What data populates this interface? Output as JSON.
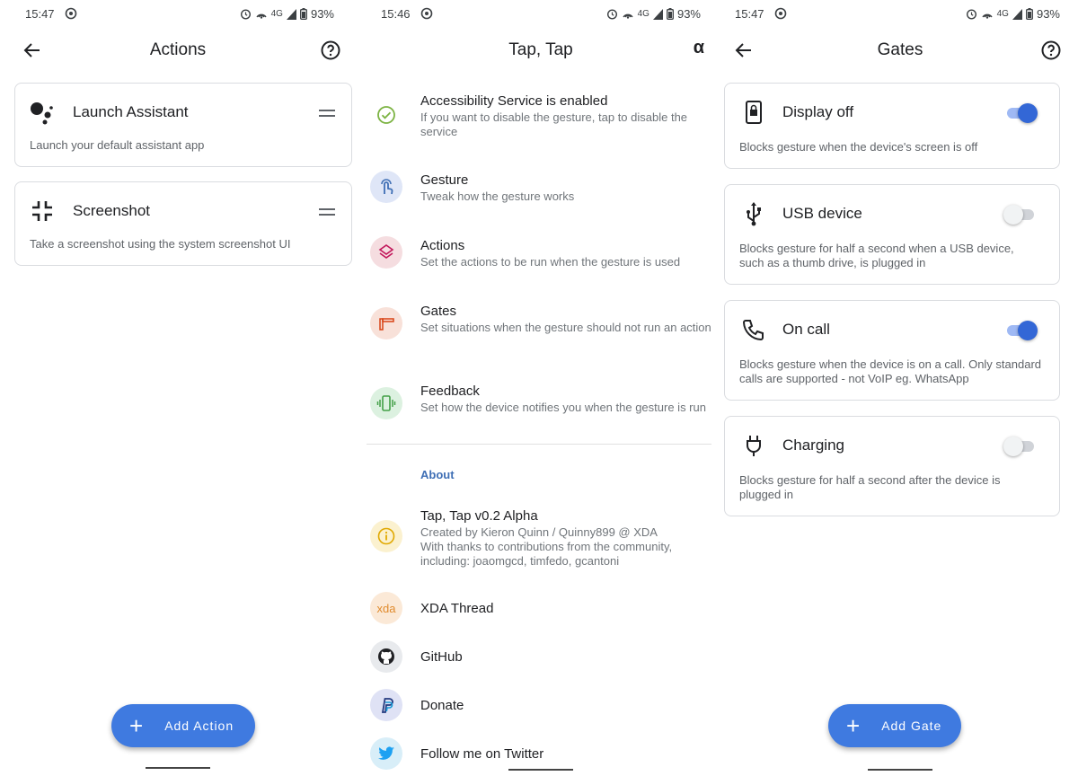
{
  "status": {
    "screen1": {
      "time": "15:47",
      "battery": "93%",
      "network": "4G"
    },
    "screen2": {
      "time": "15:46",
      "battery": "93%",
      "network": "4G"
    },
    "screen3": {
      "time": "15:47",
      "battery": "93%",
      "network": "4G"
    }
  },
  "actions_screen": {
    "title": "Actions",
    "cards": [
      {
        "title": "Launch Assistant",
        "description": "Launch your default assistant app"
      },
      {
        "title": "Screenshot",
        "description": "Take a screenshot using the system screenshot UI"
      }
    ],
    "fab_label": "Add Action"
  },
  "main_screen": {
    "title": "Tap, Tap",
    "alpha_symbol": "α",
    "items": [
      {
        "title": "Accessibility Service is enabled",
        "subtitle": "If you want to disable the gesture, tap to disable the service",
        "icon": "check-circle-icon"
      },
      {
        "title": "Gesture",
        "subtitle": "Tweak how the gesture works",
        "icon": "touch-icon"
      },
      {
        "title": "Actions",
        "subtitle": "Set the actions to be run when the gesture is used",
        "icon": "layers-icon"
      },
      {
        "title": "Gates",
        "subtitle": "Set situations when the gesture should not run an action",
        "icon": "gate-icon"
      },
      {
        "title": "Feedback",
        "subtitle": "Set how the device notifies you when the gesture is run",
        "icon": "vibration-icon"
      }
    ],
    "about_label": "About",
    "about": {
      "title": "Tap, Tap v0.2 Alpha",
      "subtitle": "Created by Kieron Quinn / Quinny899 @ XDA\nWith thanks to contributions from the community, including: joaomgcd, timfedo, gcantoni"
    },
    "links": [
      {
        "title": "XDA Thread",
        "icon": "xda-icon",
        "icon_text": "xda"
      },
      {
        "title": "GitHub",
        "icon": "github-icon"
      },
      {
        "title": "Donate",
        "icon": "paypal-icon"
      },
      {
        "title": "Follow me on Twitter",
        "icon": "twitter-icon"
      }
    ]
  },
  "gates_screen": {
    "title": "Gates",
    "cards": [
      {
        "title": "Display off",
        "description": "Blocks gesture when the device's screen is off",
        "enabled": true
      },
      {
        "title": "USB device",
        "description": "Blocks gesture for half a second when a USB device, such as a thumb drive, is plugged in",
        "enabled": false
      },
      {
        "title": "On call",
        "description": "Blocks gesture when the device is on a call. Only standard calls are supported - not VoIP eg. WhatsApp",
        "enabled": true
      },
      {
        "title": "Charging",
        "description": "Blocks gesture for half a second after the device is plugged in",
        "enabled": false
      }
    ],
    "fab_label": "Add Gate"
  },
  "colors": {
    "accent": "#3f7ae0",
    "toggle_on": "#3367d6",
    "section_label": "#3f6fb5"
  }
}
